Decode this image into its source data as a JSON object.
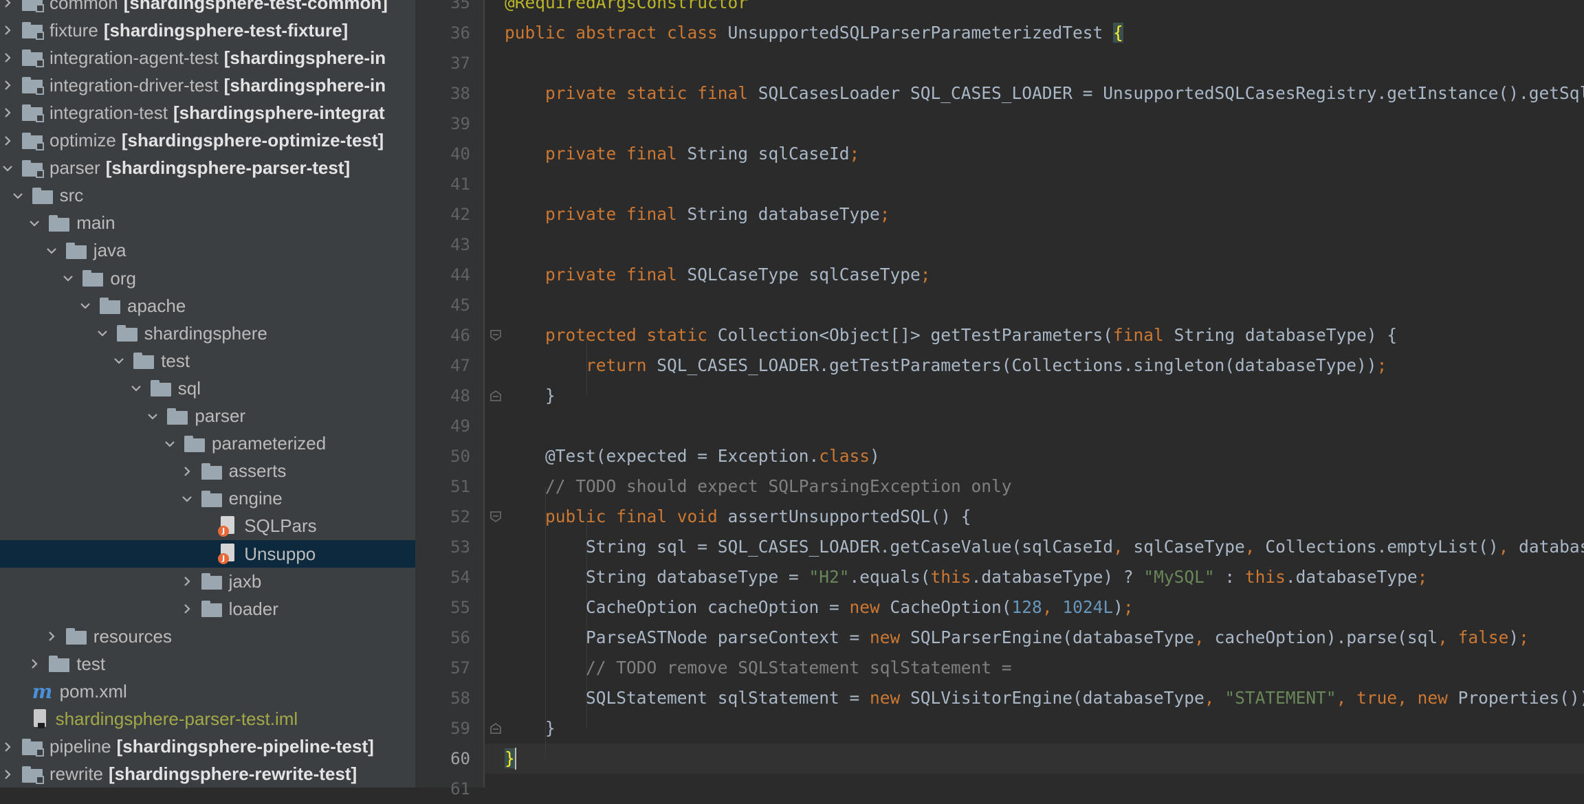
{
  "project_tree": {
    "rows": [
      {
        "type": "module",
        "depth": 0,
        "arrow": "collapsed",
        "label": "common",
        "bold": "[shardingsphere-test-common]"
      },
      {
        "type": "module",
        "depth": 0,
        "arrow": "collapsed",
        "label": "fixture",
        "bold": "[shardingsphere-test-fixture]"
      },
      {
        "type": "module",
        "depth": 0,
        "arrow": "collapsed",
        "label": "integration-agent-test",
        "bold": "[shardingsphere-in"
      },
      {
        "type": "module",
        "depth": 0,
        "arrow": "collapsed",
        "label": "integration-driver-test",
        "bold": "[shardingsphere-in"
      },
      {
        "type": "module",
        "depth": 0,
        "arrow": "collapsed",
        "label": "integration-test",
        "bold": "[shardingsphere-integrat"
      },
      {
        "type": "module",
        "depth": 0,
        "arrow": "collapsed",
        "label": "optimize",
        "bold": "[shardingsphere-optimize-test]"
      },
      {
        "type": "module",
        "depth": 0,
        "arrow": "expanded",
        "label": "parser",
        "bold": "[shardingsphere-parser-test]"
      },
      {
        "type": "folder",
        "depth": 1,
        "arrow": "expanded",
        "label": "src"
      },
      {
        "type": "folder",
        "depth": 2,
        "arrow": "expanded",
        "label": "main"
      },
      {
        "type": "folder",
        "depth": 3,
        "arrow": "expanded",
        "label": "java"
      },
      {
        "type": "folder",
        "depth": 4,
        "arrow": "expanded",
        "label": "org"
      },
      {
        "type": "folder",
        "depth": 5,
        "arrow": "expanded",
        "label": "apache"
      },
      {
        "type": "folder",
        "depth": 6,
        "arrow": "expanded",
        "label": "shardingsphere"
      },
      {
        "type": "folder",
        "depth": 7,
        "arrow": "expanded",
        "label": "test"
      },
      {
        "type": "folder",
        "depth": 8,
        "arrow": "expanded",
        "label": "sql"
      },
      {
        "type": "folder",
        "depth": 9,
        "arrow": "expanded",
        "label": "parser"
      },
      {
        "type": "folder",
        "depth": 10,
        "arrow": "expanded",
        "label": "parameterized"
      },
      {
        "type": "folder",
        "depth": 11,
        "arrow": "collapsed",
        "label": "asserts"
      },
      {
        "type": "folder",
        "depth": 11,
        "arrow": "expanded",
        "label": "engine"
      },
      {
        "type": "java",
        "depth": 12,
        "arrow": "none",
        "label": "SQLPars"
      },
      {
        "type": "java",
        "depth": 12,
        "arrow": "none",
        "label": "Unsuppo",
        "selected": true
      },
      {
        "type": "folder",
        "depth": 11,
        "arrow": "collapsed",
        "label": "jaxb"
      },
      {
        "type": "folder",
        "depth": 11,
        "arrow": "collapsed",
        "label": "loader"
      },
      {
        "type": "folder",
        "depth": 3,
        "arrow": "collapsed",
        "label": "resources"
      },
      {
        "type": "folder",
        "depth": 2,
        "arrow": "collapsed",
        "label": "test"
      },
      {
        "type": "pom",
        "depth": 1,
        "arrow": "none",
        "label": "pom.xml"
      },
      {
        "type": "iml",
        "depth": 1,
        "arrow": "none",
        "label": "shardingsphere-parser-test.iml"
      },
      {
        "type": "module",
        "depth": 0,
        "arrow": "collapsed",
        "label": "pipeline",
        "bold": "[shardingsphere-pipeline-test]"
      },
      {
        "type": "module",
        "depth": 0,
        "arrow": "collapsed",
        "label": "rewrite",
        "bold": "[shardingsphere-rewrite-test]"
      },
      {
        "type": "module",
        "depth": 0,
        "arrow": "collapsed",
        "label": "",
        "bold": ""
      }
    ]
  },
  "editor": {
    "current_line": "60",
    "lines": [
      {
        "num": "35",
        "fold": "",
        "tokens": [
          [
            "ann",
            "@RequiredArgsConstructor"
          ]
        ]
      },
      {
        "num": "36",
        "fold": "",
        "tokens": [
          [
            "kw",
            "public abstract class "
          ],
          [
            "",
            "UnsupportedSQLParserParameterizedTest "
          ],
          [
            "brace",
            "{"
          ]
        ]
      },
      {
        "num": "37",
        "fold": "",
        "tokens": []
      },
      {
        "num": "38",
        "fold": "",
        "tokens": [
          [
            "",
            "    "
          ],
          [
            "kw",
            "private static final "
          ],
          [
            "",
            "SQLCasesLoader SQL_CASES_LOADER = UnsupportedSQLCasesRegistry.getInstance().getSqlCasesLoader()"
          ],
          [
            "kw",
            ";"
          ]
        ]
      },
      {
        "num": "39",
        "fold": "",
        "tokens": []
      },
      {
        "num": "40",
        "fold": "",
        "tokens": [
          [
            "",
            "    "
          ],
          [
            "kw",
            "private final "
          ],
          [
            "",
            "String sqlCaseId"
          ],
          [
            "kw",
            ";"
          ]
        ]
      },
      {
        "num": "41",
        "fold": "",
        "tokens": []
      },
      {
        "num": "42",
        "fold": "",
        "tokens": [
          [
            "",
            "    "
          ],
          [
            "kw",
            "private final "
          ],
          [
            "",
            "String databaseType"
          ],
          [
            "kw",
            ";"
          ]
        ]
      },
      {
        "num": "43",
        "fold": "",
        "tokens": []
      },
      {
        "num": "44",
        "fold": "",
        "tokens": [
          [
            "",
            "    "
          ],
          [
            "kw",
            "private final "
          ],
          [
            "",
            "SQLCaseType sqlCaseType"
          ],
          [
            "kw",
            ";"
          ]
        ]
      },
      {
        "num": "45",
        "fold": "",
        "tokens": []
      },
      {
        "num": "46",
        "fold": "open",
        "tokens": [
          [
            "",
            "    "
          ],
          [
            "kw",
            "protected static "
          ],
          [
            "",
            "Collection<Object[]> getTestParameters("
          ],
          [
            "kw",
            "final "
          ],
          [
            "",
            "String databaseType) {"
          ]
        ]
      },
      {
        "num": "47",
        "fold": "",
        "tokens": [
          [
            "",
            "        "
          ],
          [
            "kw",
            "return "
          ],
          [
            "",
            "SQL_CASES_LOADER.getTestParameters(Collections.singleton(databaseType))"
          ],
          [
            "kw",
            ";"
          ]
        ]
      },
      {
        "num": "48",
        "fold": "close",
        "tokens": [
          [
            "",
            "    }"
          ]
        ]
      },
      {
        "num": "49",
        "fold": "",
        "tokens": []
      },
      {
        "num": "50",
        "fold": "",
        "tokens": [
          [
            "",
            "    @Test(expected = Exception."
          ],
          [
            "kw",
            "class"
          ],
          [
            "",
            ")"
          ]
        ]
      },
      {
        "num": "51",
        "fold": "",
        "tokens": [
          [
            "",
            "    "
          ],
          [
            "cmt",
            "// TODO should expect SQLParsingException only"
          ]
        ]
      },
      {
        "num": "52",
        "fold": "open",
        "tokens": [
          [
            "",
            "    "
          ],
          [
            "kw",
            "public final void "
          ],
          [
            "",
            "assertUnsupportedSQL() {"
          ]
        ]
      },
      {
        "num": "53",
        "fold": "",
        "tokens": [
          [
            "",
            "        String sql = SQL_CASES_LOADER.getCaseValue(sqlCaseId"
          ],
          [
            "kw",
            ", "
          ],
          [
            "",
            "sqlCaseType"
          ],
          [
            "kw",
            ", "
          ],
          [
            "",
            "Collections.emptyList()"
          ],
          [
            "kw",
            ", "
          ],
          [
            "",
            "databaseType)"
          ],
          [
            "kw",
            ";"
          ]
        ]
      },
      {
        "num": "54",
        "fold": "",
        "tokens": [
          [
            "",
            "        String databaseType = "
          ],
          [
            "str",
            "\"H2\""
          ],
          [
            "",
            ".equals("
          ],
          [
            "kw",
            "this"
          ],
          [
            "",
            ".databaseType) ? "
          ],
          [
            "str",
            "\"MySQL\""
          ],
          [
            "",
            " : "
          ],
          [
            "kw",
            "this"
          ],
          [
            "",
            ".databaseType"
          ],
          [
            "kw",
            ";"
          ]
        ]
      },
      {
        "num": "55",
        "fold": "",
        "tokens": [
          [
            "",
            "        CacheOption cacheOption = "
          ],
          [
            "kw",
            "new "
          ],
          [
            "",
            "CacheOption("
          ],
          [
            "num",
            "128"
          ],
          [
            "kw",
            ", "
          ],
          [
            "num",
            "1024L"
          ],
          [
            "",
            ")"
          ],
          [
            "kw",
            ";"
          ]
        ]
      },
      {
        "num": "56",
        "fold": "",
        "tokens": [
          [
            "",
            "        ParseASTNode parseContext = "
          ],
          [
            "kw",
            "new "
          ],
          [
            "",
            "SQLParserEngine(databaseType"
          ],
          [
            "kw",
            ", "
          ],
          [
            "",
            "cacheOption).parse(sql"
          ],
          [
            "kw",
            ", false"
          ],
          [
            "",
            ")"
          ],
          [
            "kw",
            ";"
          ]
        ]
      },
      {
        "num": "57",
        "fold": "",
        "tokens": [
          [
            "",
            "        "
          ],
          [
            "cmt",
            "// TODO remove SQLStatement sqlStatement ="
          ]
        ]
      },
      {
        "num": "58",
        "fold": "",
        "tokens": [
          [
            "",
            "        SQLStatement sqlStatement = "
          ],
          [
            "kw",
            "new "
          ],
          [
            "",
            "SQLVisitorEngine(databaseType"
          ],
          [
            "kw",
            ", "
          ],
          [
            "str",
            "\"STATEMENT\""
          ],
          [
            "kw",
            ", true, new "
          ],
          [
            "",
            "Properties()).visit(parseContext)"
          ],
          [
            "kw",
            ";"
          ]
        ]
      },
      {
        "num": "59",
        "fold": "close",
        "tokens": [
          [
            "",
            "    }"
          ]
        ]
      },
      {
        "num": "60",
        "fold": "",
        "tokens": [
          [
            "brace",
            "}"
          ]
        ]
      },
      {
        "num": "61",
        "fold": "",
        "tokens": []
      }
    ]
  },
  "colors": {
    "tree_bg": "#3c3f41",
    "editor_bg": "#2b2b2b",
    "selection": "#0d293e",
    "keyword": "#cc7832",
    "string": "#6a8759",
    "number": "#6897bb",
    "annotation": "#bbb529",
    "comment": "#808080"
  }
}
